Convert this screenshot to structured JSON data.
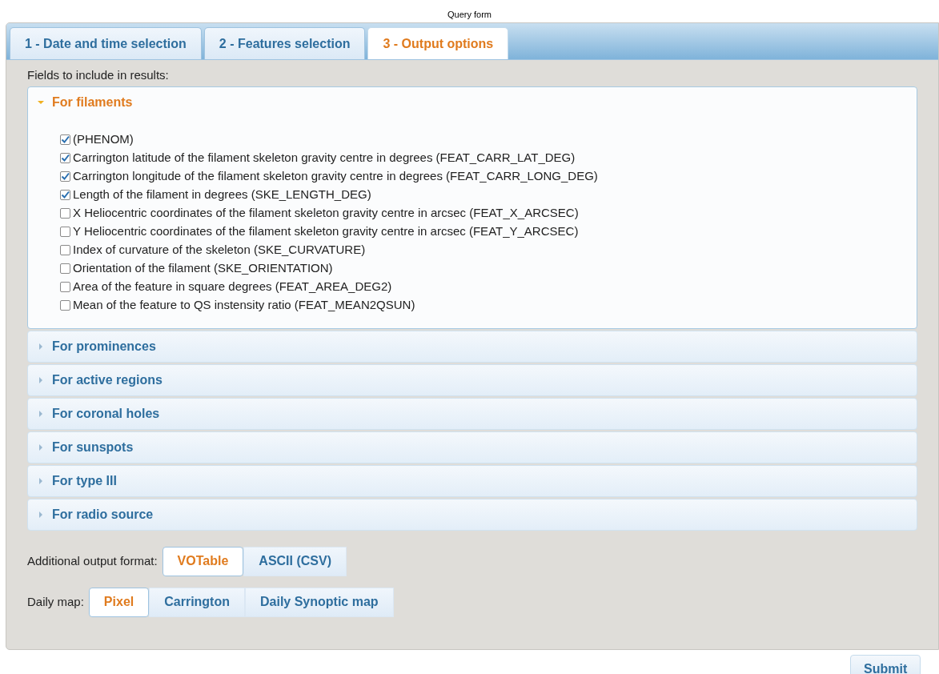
{
  "window": {
    "title": "Query form"
  },
  "tabs": [
    {
      "label": "1 - Date and time selection",
      "selected": false
    },
    {
      "label": "2 - Features selection",
      "selected": false
    },
    {
      "label": "3 - Output options",
      "selected": true
    }
  ],
  "fields_label": "Fields to include in results:",
  "sections": [
    {
      "title": "For filaments",
      "expanded": true,
      "fields": [
        {
          "label": "(PHENOM)",
          "checked": true
        },
        {
          "label": "Carrington latitude of the filament skeleton gravity centre in degrees (FEAT_CARR_LAT_DEG)",
          "checked": true
        },
        {
          "label": "Carrington longitude of the filament skeleton gravity centre in degrees (FEAT_CARR_LONG_DEG)",
          "checked": true
        },
        {
          "label": "Length of the filament in degrees (SKE_LENGTH_DEG)",
          "checked": true
        },
        {
          "label": "X Heliocentric coordinates of the filament skeleton gravity centre in arcsec (FEAT_X_ARCSEC)",
          "checked": false
        },
        {
          "label": "Y Heliocentric coordinates of the filament skeleton gravity centre in arcsec (FEAT_Y_ARCSEC)",
          "checked": false
        },
        {
          "label": "Index of curvature of the skeleton (SKE_CURVATURE)",
          "checked": false
        },
        {
          "label": "Orientation of the filament (SKE_ORIENTATION)",
          "checked": false
        },
        {
          "label": "Area of the feature in square degrees (FEAT_AREA_DEG2)",
          "checked": false
        },
        {
          "label": "Mean of the feature to QS instensity ratio (FEAT_MEAN2QSUN)",
          "checked": false
        }
      ]
    },
    {
      "title": "For prominences",
      "expanded": false
    },
    {
      "title": "For active regions",
      "expanded": false
    },
    {
      "title": "For coronal holes",
      "expanded": false
    },
    {
      "title": "For sunspots",
      "expanded": false
    },
    {
      "title": "For type III",
      "expanded": false
    },
    {
      "title": "For radio source",
      "expanded": false
    }
  ],
  "option_groups": [
    {
      "label": "Additional output format:",
      "options": [
        {
          "label": "VOTable",
          "selected": true
        },
        {
          "label": "ASCII (CSV)",
          "selected": false
        }
      ]
    },
    {
      "label": "Daily map:",
      "options": [
        {
          "label": "Pixel",
          "selected": true
        },
        {
          "label": "Carrington",
          "selected": false
        },
        {
          "label": "Daily Synoptic map",
          "selected": false
        }
      ]
    }
  ],
  "submit": "Submit"
}
